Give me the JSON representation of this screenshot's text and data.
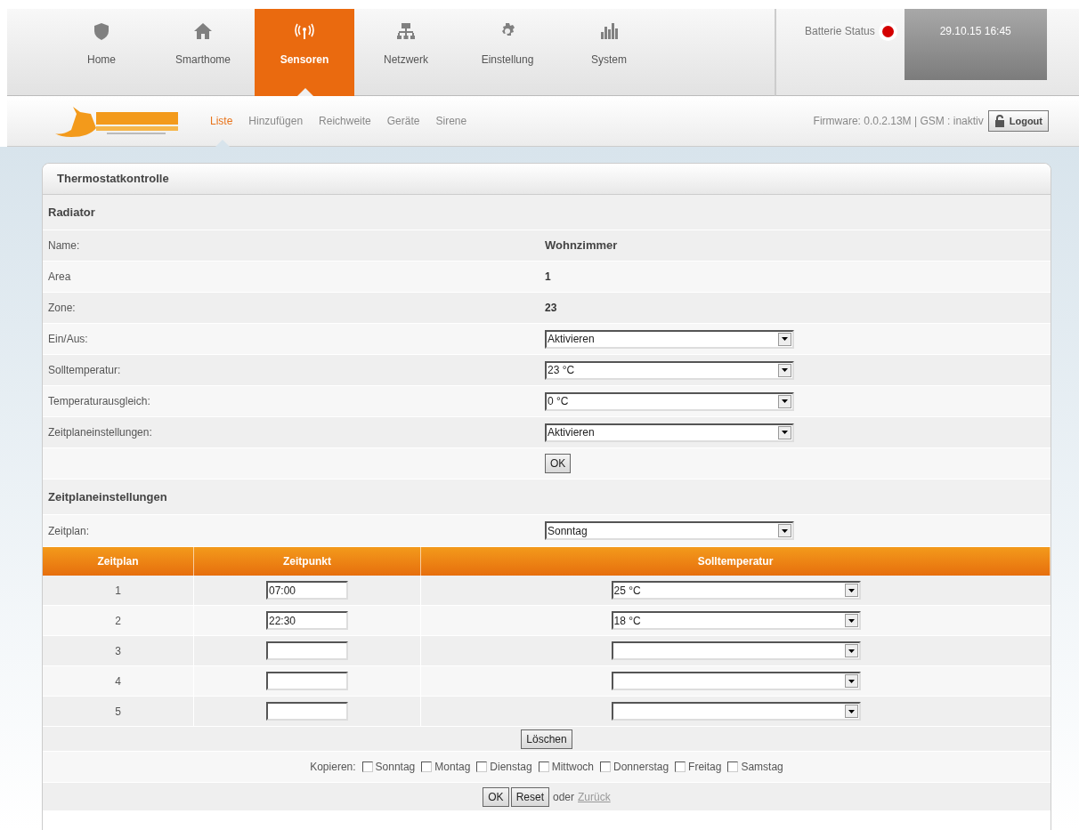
{
  "nav": {
    "items": [
      {
        "label": "Home",
        "selected": false
      },
      {
        "label": "Smarthome",
        "selected": false
      },
      {
        "label": "Sensoren",
        "selected": true
      },
      {
        "label": "Netzwerk",
        "selected": false
      },
      {
        "label": "Einstellung",
        "selected": false
      },
      {
        "label": "System",
        "selected": false
      }
    ]
  },
  "status": {
    "battery_label": "Batterie Status",
    "battery_ok": false,
    "datetime": "29.10.15 16:45"
  },
  "subnav": {
    "items": [
      {
        "label": "Liste",
        "selected": true
      },
      {
        "label": "Hinzufügen",
        "selected": false
      },
      {
        "label": "Reichweite",
        "selected": false
      },
      {
        "label": "Geräte",
        "selected": false
      },
      {
        "label": "Sirene",
        "selected": false
      }
    ],
    "info": "Firmware: 0.0.2.13M | GSM : inaktiv",
    "logout": "Logout"
  },
  "panel": {
    "title": "Thermostatkontrolle",
    "device": {
      "title": "Radiator",
      "fields": [
        {
          "kind": "text",
          "label": "Name:",
          "value": "Wohnzimmer"
        },
        {
          "kind": "text",
          "label": "Area",
          "value": "1"
        },
        {
          "kind": "text",
          "label": "Zone:",
          "value": "23"
        },
        {
          "kind": "select",
          "label": "Ein/Aus:",
          "value": "Aktivieren"
        },
        {
          "kind": "select",
          "label": "Solltemperatur:",
          "value": "23 °C"
        },
        {
          "kind": "select",
          "label": "Temperaturausgleich:",
          "value": "0 °C"
        },
        {
          "kind": "select",
          "label": "Zeitplaneinstellungen:",
          "value": "Aktivieren"
        }
      ],
      "ok_button": "OK"
    },
    "schedule": {
      "title": "Zeitplaneinstellungen",
      "day_label": "Zeitplan:",
      "day_value": "Sonntag",
      "columns": [
        "Zeitplan",
        "Zeitpunkt",
        "Solltemperatur"
      ],
      "rows": [
        {
          "number": "1",
          "time": "07:00",
          "temperature": "25 °C"
        },
        {
          "number": "2",
          "time": "22:30",
          "temperature": "18 °C"
        },
        {
          "number": "3"
        },
        {
          "number": "4"
        },
        {
          "number": "5"
        }
      ],
      "delete_button": "Löschen",
      "copy_label": "Kopieren:",
      "copy_days": [
        {
          "label": "Sonntag",
          "checked": false
        },
        {
          "label": "Montag",
          "checked": false
        },
        {
          "label": "Dienstag",
          "checked": false
        },
        {
          "label": "Mittwoch",
          "checked": false
        },
        {
          "label": "Donnerstag",
          "checked": false
        },
        {
          "label": "Freitag",
          "checked": false
        },
        {
          "label": "Samstag",
          "checked": false
        }
      ],
      "ok_button": "OK",
      "reset_button": "Reset",
      "or_text": "oder",
      "back_link": "Zurück"
    }
  }
}
